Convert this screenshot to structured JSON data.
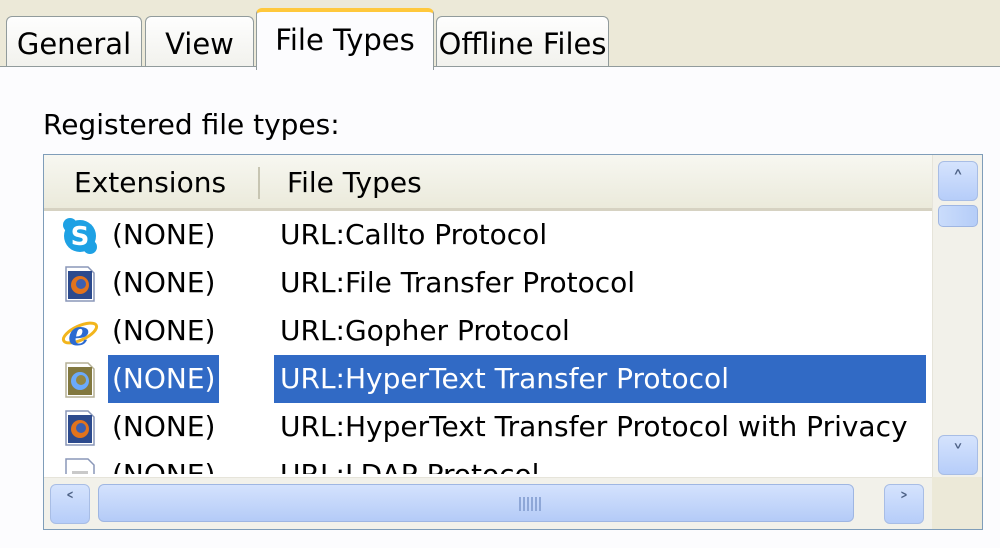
{
  "tabs": [
    {
      "label": "General",
      "active": false
    },
    {
      "label": "View",
      "active": false
    },
    {
      "label": "File Types",
      "active": true
    },
    {
      "label": "Offline Files",
      "active": false
    }
  ],
  "registered_label": "Registered file types:",
  "list": {
    "columns": [
      "Extensions",
      "File Types"
    ],
    "rows": [
      {
        "ext": "(NONE)",
        "type": "URL:Callto Protocol",
        "icon": "skype-icon"
      },
      {
        "ext": "(NONE)",
        "type": "URL:File Transfer Protocol",
        "icon": "firefox-document-icon"
      },
      {
        "ext": "(NONE)",
        "type": "URL:Gopher Protocol",
        "icon": "internet-explorer-icon"
      },
      {
        "ext": "(NONE)",
        "type": "URL:HyperText Transfer Protocol",
        "icon": "firefox-document-icon",
        "selected": true
      },
      {
        "ext": "(NONE)",
        "type": "URL:HyperText Transfer Protocol with Privacy",
        "icon": "firefox-document-icon"
      },
      {
        "ext": "(NONE)",
        "type": "URL:LDAP Protocol",
        "icon": "ldap-document-icon"
      }
    ]
  },
  "colors": {
    "selection": "#316ac5",
    "tab_accent": "#ffc83c"
  }
}
